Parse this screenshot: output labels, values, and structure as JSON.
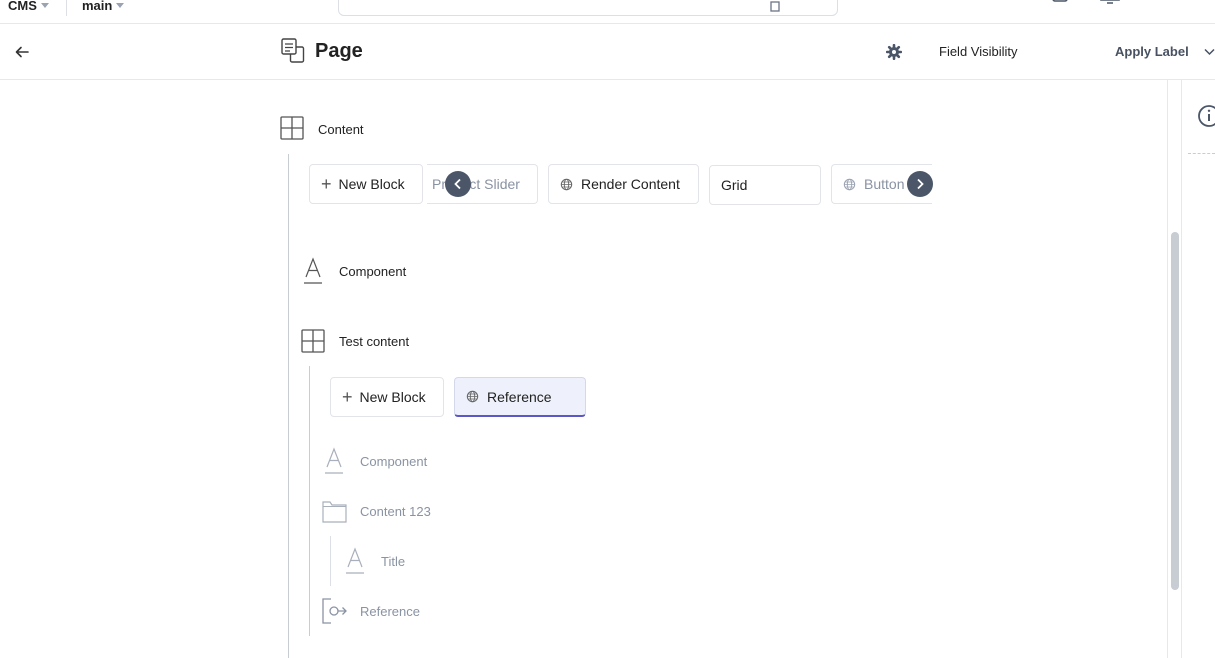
{
  "topbar": {
    "app_label": "CMS",
    "branch_label": "main"
  },
  "header": {
    "back_icon": "arrow-left-icon",
    "page_icon": "page-icon",
    "title": "Page",
    "settings_icon": "gear-icon",
    "field_visibility": "Field Visibility",
    "apply_label": "Apply Label"
  },
  "tree": {
    "content": {
      "label": "Content",
      "new_block": "New Block",
      "block_types": [
        "Product Slider",
        "Render Content",
        "Grid",
        "Button"
      ]
    },
    "component": {
      "label": "Component"
    },
    "test_content": {
      "label": "Test content",
      "new_block": "New Block",
      "selected_type": "Reference",
      "children": {
        "component": "Component",
        "content_123": "Content 123",
        "title": "Title",
        "reference": "Reference"
      }
    }
  },
  "colors": {
    "accent": "#5b57c7",
    "nav_button": "#4b5669",
    "muted_text": "#8a93a3"
  }
}
